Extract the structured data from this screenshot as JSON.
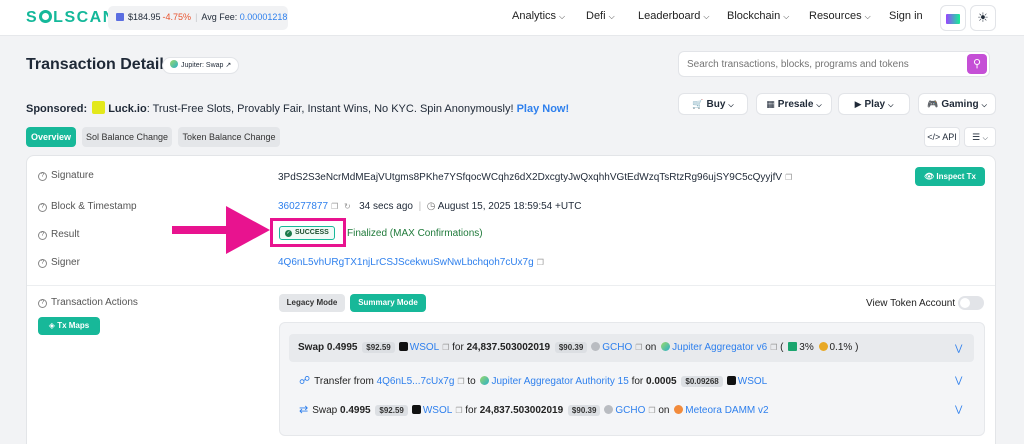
{
  "header": {
    "logo": "SOLSCAN",
    "price": "$184.95",
    "change": "-4.75%",
    "avg_fee_label": "Avg Fee:",
    "avg_fee": "0.00001218",
    "nav": [
      "Analytics",
      "Defi",
      "Leaderboard",
      "Blockchain",
      "Resources",
      "Sign in"
    ]
  },
  "title": "Transaction Details",
  "title_badge": "Jupiter: Swap",
  "search": {
    "placeholder": "Search transactions, blocks, programs and tokens"
  },
  "sponsored": {
    "label": "Sponsored:",
    "brand": "Luck.io",
    "text": ": Trust-Free Slots, Provably Fair, Instant Wins, No KYC. Spin Anonymously!",
    "cta": "Play Now!"
  },
  "pills": [
    "Buy",
    "Presale",
    "Play",
    "Gaming"
  ],
  "tabs": [
    "Overview",
    "Sol Balance Change",
    "Token Balance Change"
  ],
  "api_label": "API",
  "details": {
    "signature_label": "Signature",
    "signature": "3PdS2S3eNcrMdMEajVUtgms8PKhe7YSfqocWCqhz6dX2DxcgtyJwQxqhhVGtEdWzqTsRtzRg96ujSY9C5cQyyjfV",
    "inspect_label": "Inspect Tx",
    "block_label": "Block & Timestamp",
    "block": "360277877",
    "ago": "34 secs ago",
    "timestamp": "August 15, 2025 18:59:54 +UTC",
    "result_label": "Result",
    "result_status": "SUCCESS",
    "result_text": "Finalized (MAX Confirmations)",
    "signer_label": "Signer",
    "signer": "4Q6nL5vhURgTX1njLrCSJScekwuSwNwLbchqoh7cUx7g"
  },
  "actions": {
    "label": "Transaction Actions",
    "tx_maps": "Tx Maps",
    "legacy_mode": "Legacy Mode",
    "summary_mode": "Summary Mode",
    "view_token_account": "View Token Account",
    "row1": {
      "verb": "Swap",
      "amount": "0.4995",
      "usd1": "$92.59",
      "token1": "WSOL",
      "for": "for",
      "amount2": "24,837.503002019",
      "usd2": "$90.39",
      "token2": "GCHO",
      "on": "on",
      "platform": "Jupiter Aggregator v6",
      "pct1": "3%",
      "pct2": "0.1%"
    },
    "row2": {
      "verb": "Transfer from",
      "from": "4Q6nL5...7cUx7g",
      "to_word": "to",
      "to": "Jupiter Aggregator Authority 15",
      "for": "for",
      "amount": "0.0005",
      "usd": "$0.09268",
      "token": "WSOL"
    },
    "row3": {
      "verb": "Swap",
      "amount": "0.4995",
      "usd1": "$92.59",
      "token1": "WSOL",
      "for": "for",
      "amount2": "24,837.503002019",
      "usd2": "$90.39",
      "token2": "GCHO",
      "on": "on",
      "platform": "Meteora DAMM v2"
    }
  }
}
